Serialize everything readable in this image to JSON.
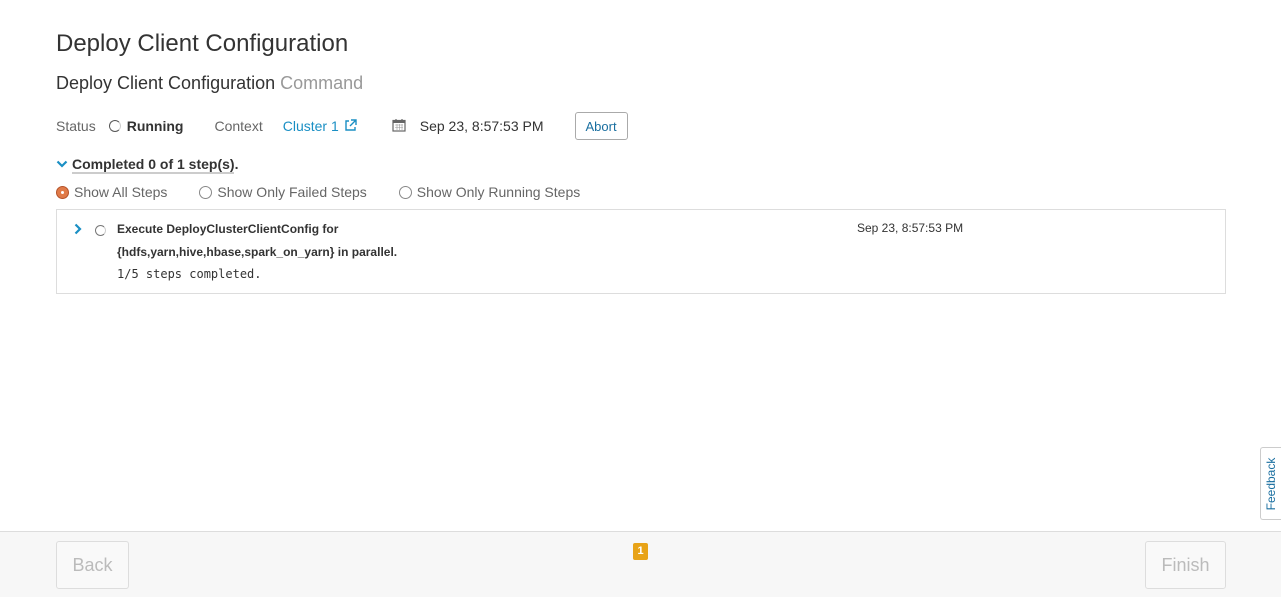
{
  "header": {
    "title": "Deploy Client Configuration",
    "subtitle_main": "Deploy Client Configuration",
    "subtitle_suffix": "Command"
  },
  "status": {
    "status_label": "Status",
    "status_value": "Running",
    "context_label": "Context",
    "context_link": "Cluster 1",
    "started": "Sep 23, 8:57:53 PM",
    "abort_label": "Abort"
  },
  "progress": {
    "summary": "Completed 0 of 1 step(s)."
  },
  "filters": [
    {
      "label": "Show All Steps",
      "selected": true
    },
    {
      "label": "Show Only Failed Steps",
      "selected": false
    },
    {
      "label": "Show Only Running Steps",
      "selected": false
    }
  ],
  "steps": [
    {
      "title": "Execute DeployClusterClientConfig for {hdfs,yarn,hive,hbase,spark_on_yarn} in parallel.",
      "detail": "1/5 steps completed.",
      "time": "Sep 23, 8:57:53 PM"
    }
  ],
  "footer": {
    "back_label": "Back",
    "finish_label": "Finish",
    "page_badge": "1"
  },
  "feedback": {
    "label": "Feedback"
  },
  "colors": {
    "link": "#1a8fc4",
    "selected_radio": "#e07a48",
    "badge": "#e8a317"
  }
}
